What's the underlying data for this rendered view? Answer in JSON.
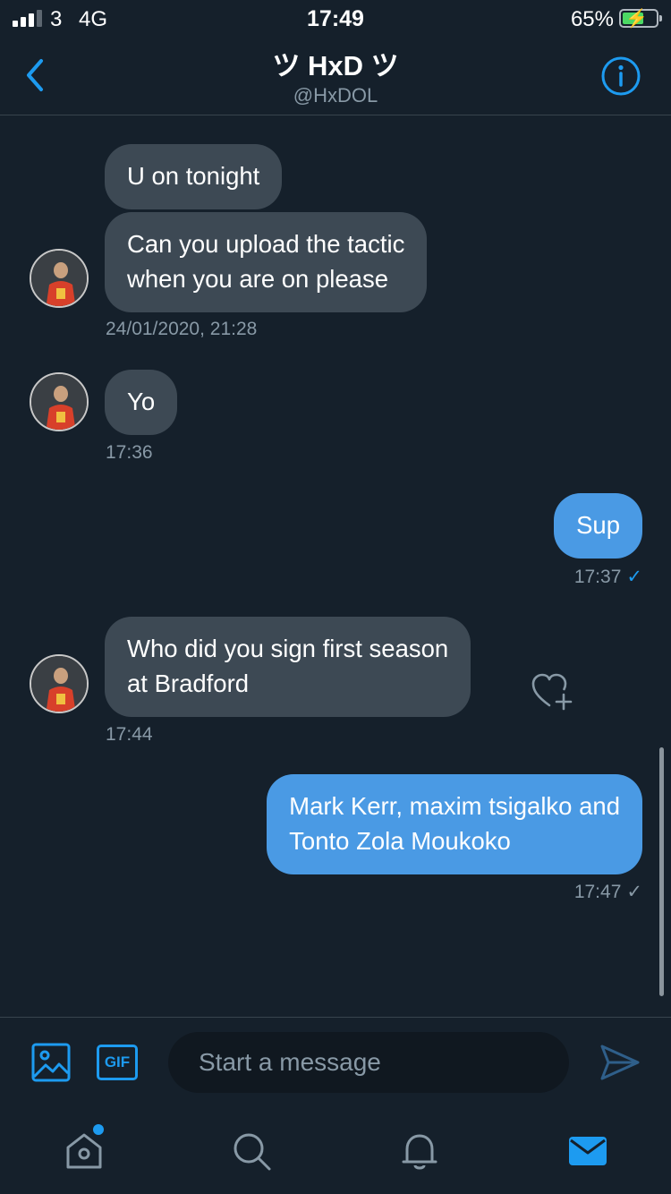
{
  "status_bar": {
    "carrier": "3",
    "network": "4G",
    "time": "17:49",
    "battery": "65%",
    "battery_level": 0.65
  },
  "header": {
    "title": "ツ HxD ツ",
    "handle": "@HxDOL",
    "back_icon": "chevron-left-icon",
    "info_icon": "info-icon"
  },
  "messages": [
    {
      "direction": "incoming",
      "text": "U on tonight"
    },
    {
      "direction": "incoming",
      "lines": [
        "Can you upload the tactic",
        "when you are on please"
      ],
      "timestamp": "24/01/2020, 21:28"
    },
    {
      "direction": "incoming",
      "text": "Yo",
      "timestamp": "17:36"
    },
    {
      "direction": "outgoing",
      "text": "Sup",
      "timestamp": "17:37",
      "status_icon": "check-icon"
    },
    {
      "direction": "incoming",
      "lines": [
        "Who did you sign first season",
        "at Bradford"
      ],
      "timestamp": "17:44",
      "action_icon": "heart-plus-icon"
    },
    {
      "direction": "outgoing",
      "lines": [
        "Mark Kerr, maxim tsigalko and",
        "Tonto Zola Moukoko"
      ],
      "timestamp": "17:47",
      "status_icon": "check-icon"
    }
  ],
  "composer": {
    "placeholder": "Start a message",
    "media_icon": "image-icon",
    "gif_label": "GIF",
    "send_icon": "send-icon"
  },
  "tab_bar": {
    "items": [
      "home-icon",
      "search-icon",
      "bell-icon",
      "mail-icon"
    ],
    "active": "mail-icon"
  },
  "colors": {
    "background": "#15202b",
    "incoming_bubble": "#3d4954",
    "outgoing_bubble": "#4a9ae4",
    "accent": "#1d9bf0",
    "muted_text": "#8899a6"
  }
}
